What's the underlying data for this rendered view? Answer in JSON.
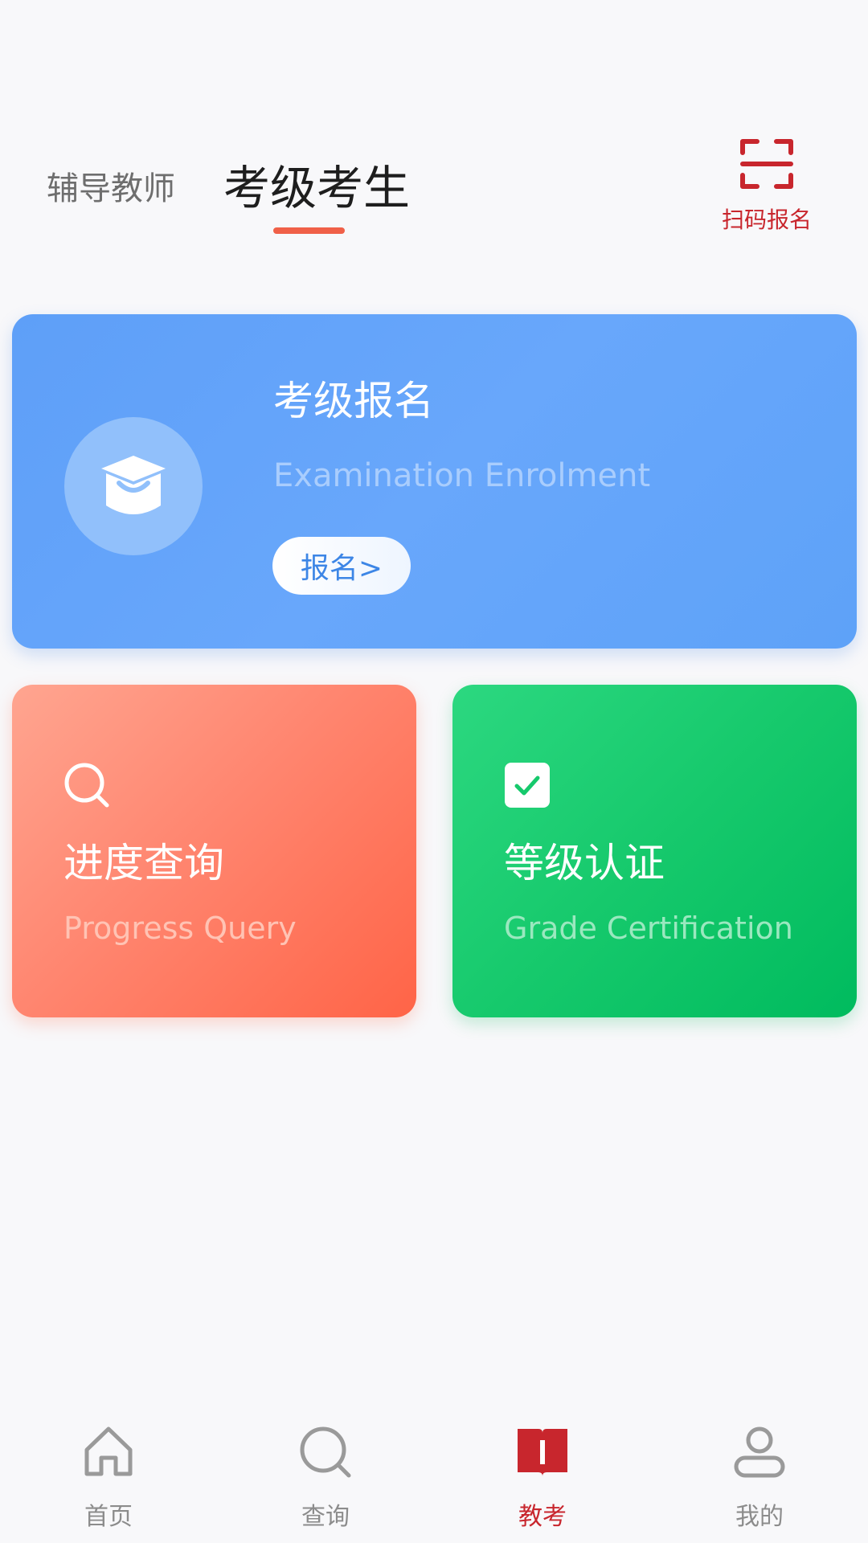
{
  "header": {
    "tabs": [
      {
        "label": "辅导教师",
        "active": false
      },
      {
        "label": "考级考生",
        "active": true
      }
    ],
    "scan": {
      "label": "扫码报名",
      "icon": "scan-icon"
    },
    "accent_color": "#c8262d"
  },
  "enrol_card": {
    "title": "考级报名",
    "subtitle": "Examination Enrolment",
    "button_label": "报名>",
    "icon": "graduation-cap-icon",
    "color": "#5e9ff8"
  },
  "cards": [
    {
      "title": "进度查询",
      "subtitle": "Progress Query",
      "icon": "search-icon",
      "color": "#ff7a5e"
    },
    {
      "title": "等级认证",
      "subtitle": "Grade Certification",
      "icon": "checkbox-icon",
      "color": "#16c96c"
    }
  ],
  "bottom_nav": [
    {
      "label": "首页",
      "icon": "home-icon",
      "active": false
    },
    {
      "label": "查询",
      "icon": "search-icon",
      "active": false
    },
    {
      "label": "教考",
      "icon": "book-icon",
      "active": true
    },
    {
      "label": "我的",
      "icon": "user-icon",
      "active": false
    }
  ]
}
